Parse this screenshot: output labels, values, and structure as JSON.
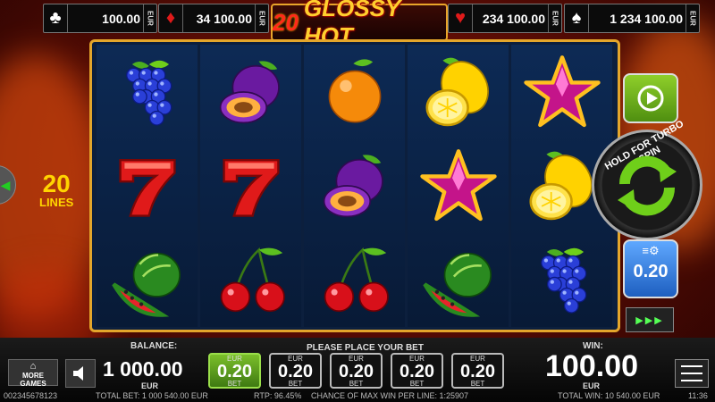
{
  "jackpots": [
    {
      "suit": "♣",
      "color": "#ffffff",
      "amount": "100.00",
      "currency": "EUR"
    },
    {
      "suit": "♦",
      "color": "#e01a1a",
      "amount": "34 100.00",
      "currency": "EUR"
    },
    {
      "suit": "♥",
      "color": "#e01a1a",
      "amount": "234 100.00",
      "currency": "EUR"
    },
    {
      "suit": "♠",
      "color": "#ffffff",
      "amount": "1 234 100.00",
      "currency": "EUR"
    }
  ],
  "logo": {
    "number": "20",
    "title": "GLOSSY HOT"
  },
  "lines": {
    "count": "20",
    "label": "LINES"
  },
  "reels": [
    [
      "grapes",
      "seven",
      "watermelon"
    ],
    [
      "plum",
      "seven",
      "cherries"
    ],
    [
      "orange",
      "plum",
      "cherries"
    ],
    [
      "lemon",
      "star",
      "watermelon"
    ],
    [
      "star",
      "lemon",
      "grapes"
    ]
  ],
  "right_panel": {
    "spin_label": "HOLD FOR TURBO SPIN",
    "bet_value": "0.20",
    "fast_forward": "▶▶▶"
  },
  "bottom": {
    "more_games": "MORE GAMES",
    "balance_label": "BALANCE:",
    "balance": "1 000.00",
    "balance_currency": "EUR",
    "place_bet": "PLEASE PLACE YOUR BET",
    "bets": [
      {
        "currency": "EUR",
        "value": "0.20",
        "label": "BET",
        "selected": true
      },
      {
        "currency": "EUR",
        "value": "0.20",
        "label": "BET",
        "selected": false
      },
      {
        "currency": "EUR",
        "value": "0.20",
        "label": "BET",
        "selected": false
      },
      {
        "currency": "EUR",
        "value": "0.20",
        "label": "BET",
        "selected": false
      },
      {
        "currency": "EUR",
        "value": "0.20",
        "label": "BET",
        "selected": false
      }
    ],
    "win_label": "WIN:",
    "win": "100.00",
    "win_currency": "EUR"
  },
  "status": {
    "id": "002345678123",
    "total_bet": "TOTAL BET: 1 000 540.00 EUR",
    "rtp": "RTP: 96.45%",
    "chance": "CHANCE OF MAX WIN PER LINE: 1:25907",
    "total_win": "TOTAL WIN: 10 540.00 EUR",
    "time": "11:36"
  },
  "colors": {
    "gold": "#e4a62b",
    "green": "#7bbf2a",
    "blue": "#1e5fc0",
    "red": "#e01a1a"
  }
}
